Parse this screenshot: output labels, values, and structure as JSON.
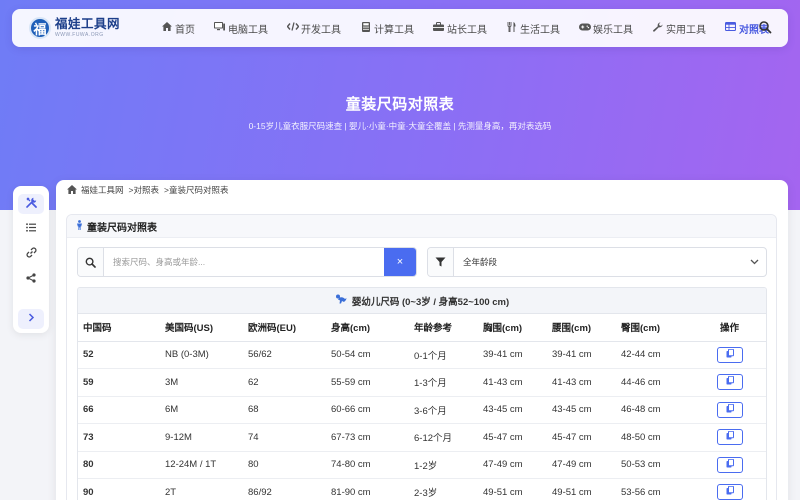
{
  "site": {
    "logo_char": "福",
    "name": "福娃工具网",
    "domain_sub": "WWW.FUWA.ORG"
  },
  "nav": [
    {
      "label": "首页",
      "icon": "home-icon"
    },
    {
      "label": "电脑工具",
      "icon": "desktop-icon"
    },
    {
      "label": "开发工具",
      "icon": "code-icon"
    },
    {
      "label": "计算工具",
      "icon": "calculator-icon"
    },
    {
      "label": "站长工具",
      "icon": "toolbox-icon"
    },
    {
      "label": "生活工具",
      "icon": "utensils-icon"
    },
    {
      "label": "娱乐工具",
      "icon": "gamepad-icon"
    },
    {
      "label": "实用工具",
      "icon": "wrench-icon"
    },
    {
      "label": "对照表",
      "icon": "table-icon",
      "active": true
    }
  ],
  "hero": {
    "title": "童装尺码对照表",
    "subtitle": "0-15岁儿童衣服尺码速查 | 婴儿·小童·中童·大童全覆盖 | 先测量身高，再对表选码"
  },
  "breadcrumb": {
    "home": "福娃工具网",
    "level1": ">对照表",
    "level2": ">童装尺码对照表"
  },
  "panel": {
    "title": "童装尺码对照表"
  },
  "search": {
    "placeholder": "搜索尺码、身高或年龄...",
    "value": "",
    "clear_symbol": "×"
  },
  "filter": {
    "selected": "全年龄段"
  },
  "table": {
    "group_title": "婴幼儿尺码 (0~3岁 / 身高52~100 cm)",
    "columns": [
      "中国码",
      "美国码(US)",
      "欧洲码(EU)",
      "身高(cm)",
      "年龄参考",
      "胸围(cm)",
      "腰围(cm)",
      "臀围(cm)",
      "操作"
    ],
    "rows": [
      [
        "52",
        "NB (0-3M)",
        "56/62",
        "50-54 cm",
        "0-1个月",
        "39-41 cm",
        "39-41 cm",
        "42-44 cm"
      ],
      [
        "59",
        "3M",
        "62",
        "55-59 cm",
        "1-3个月",
        "41-43 cm",
        "41-43 cm",
        "44-46 cm"
      ],
      [
        "66",
        "6M",
        "68",
        "60-66 cm",
        "3-6个月",
        "43-45 cm",
        "43-45 cm",
        "46-48 cm"
      ],
      [
        "73",
        "9-12M",
        "74",
        "67-73 cm",
        "6-12个月",
        "45-47 cm",
        "45-47 cm",
        "48-50 cm"
      ],
      [
        "80",
        "12-24M / 1T",
        "80",
        "74-80 cm",
        "1-2岁",
        "47-49 cm",
        "47-49 cm",
        "50-53 cm"
      ],
      [
        "90",
        "2T",
        "86/92",
        "81-90 cm",
        "2-3岁",
        "49-51 cm",
        "49-51 cm",
        "53-56 cm"
      ]
    ]
  },
  "colors": {
    "hero_start": "#6f7cf6",
    "hero_end": "#a465f0",
    "accent": "#4a6cf0",
    "active_nav": "#4a5be0"
  }
}
